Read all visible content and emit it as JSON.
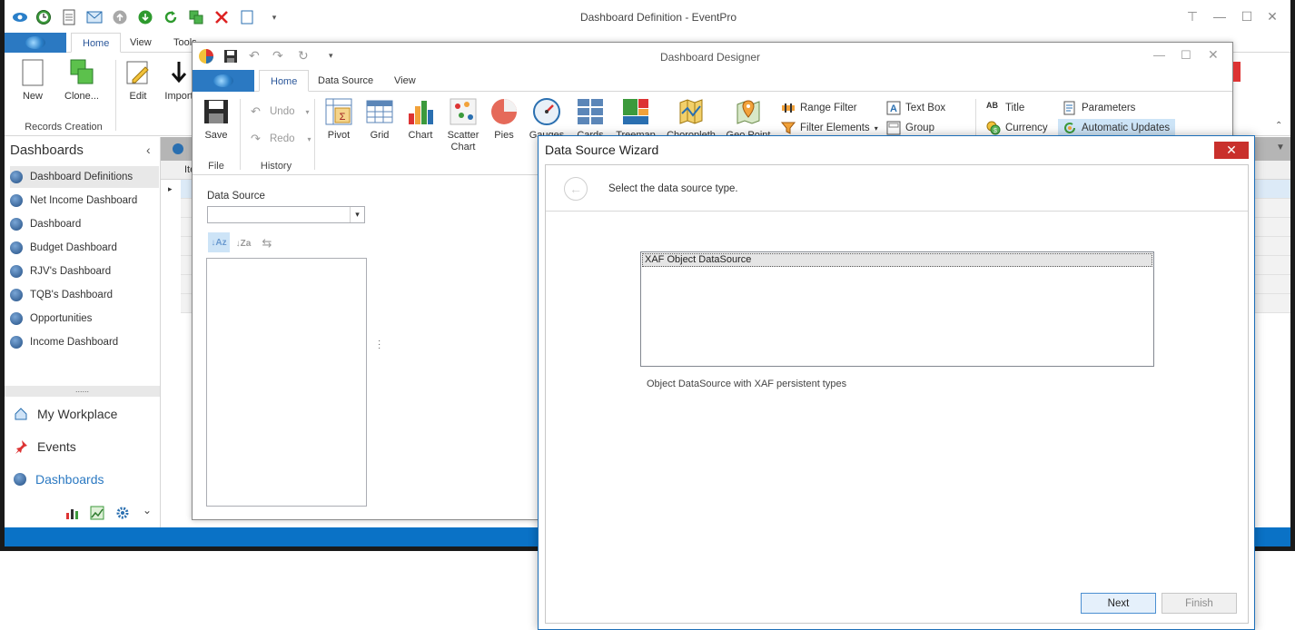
{
  "main_window": {
    "title": "Dashboard Definition - EventPro",
    "tabs": [
      "Home",
      "View",
      "Tools"
    ],
    "ribbon": {
      "new_label": "New",
      "clone_label": "Clone...",
      "edit_label": "Edit",
      "import_label": "Import",
      "group_label": "Records Creation"
    },
    "grid_header_label": "Ite"
  },
  "nav": {
    "header": "Dashboards",
    "items": [
      "Dashboard Definitions",
      "Net Income Dashboard",
      "Dashboard",
      "Budget Dashboard",
      "RJV's Dashboard",
      "TQB's Dashboard",
      "Opportunities",
      "Income Dashboard"
    ],
    "groups": [
      "My Workplace",
      "Events",
      "Dashboards"
    ],
    "splitter": "......"
  },
  "designer": {
    "title": "Dashboard Designer",
    "tabs": [
      "Home",
      "Data Source",
      "View"
    ],
    "ribbon": {
      "save_label": "Save",
      "file_group": "File",
      "undo_label": "Undo",
      "redo_label": "Redo",
      "history_group": "History",
      "items": [
        "Pivot",
        "Grid",
        "Chart",
        "Scatter Chart",
        "Pies",
        "Gauges",
        "Cards",
        "Treemap",
        "Choropleth",
        "Geo Point"
      ],
      "range_filter": "Range Filter",
      "filter_elements": "Filter Elements",
      "text_box": "Text Box",
      "group": "Group",
      "title_item": "Title",
      "currency": "Currency",
      "parameters": "Parameters",
      "automatic_updates": "Automatic Updates"
    },
    "data_source_label": "Data Source",
    "data_source_value": ""
  },
  "wizard": {
    "title": "Data Source Wizard",
    "instruction": "Select the data source type.",
    "options": [
      "XAF Object DataSource"
    ],
    "selected_option": "XAF Object DataSource",
    "description": "Object DataSource with XAF persistent types",
    "next_label": "Next",
    "finish_label": "Finish"
  },
  "colors": {
    "accent": "#2b79c2",
    "statusbar": "#0a72c6",
    "close_red": "#c9302c"
  }
}
